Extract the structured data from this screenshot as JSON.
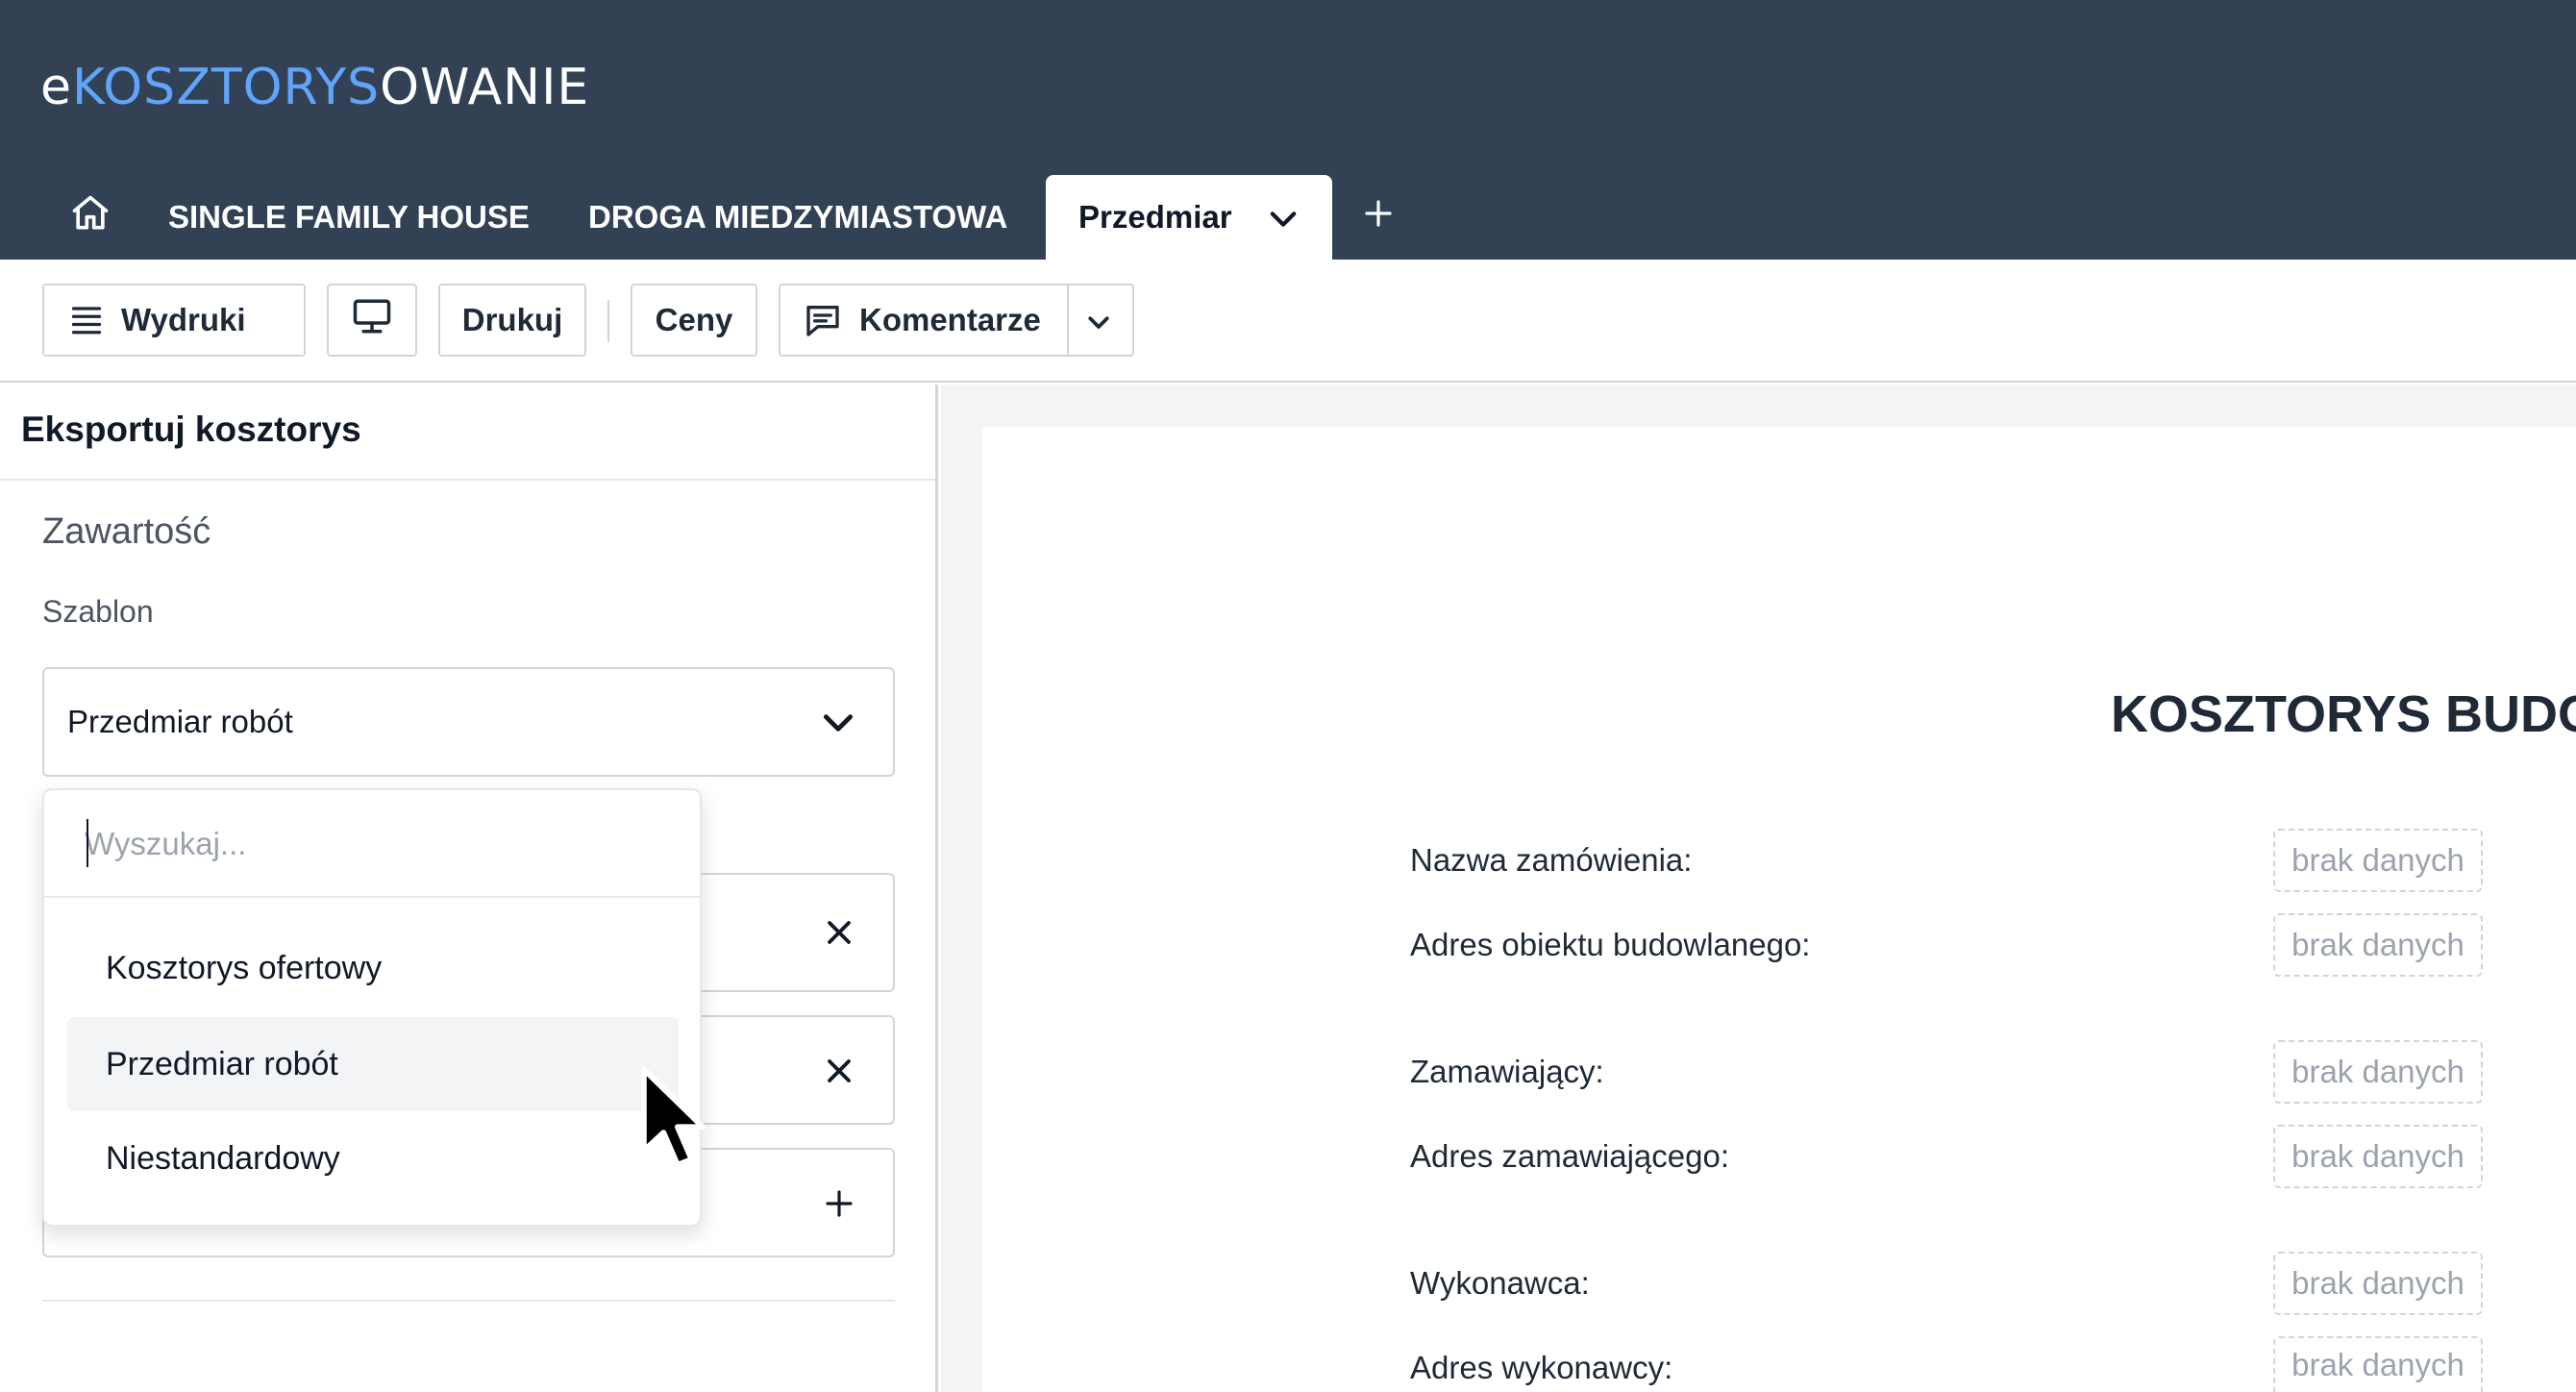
{
  "app": {
    "logo": {
      "prefix": "e",
      "middle": "KOSZTORYS",
      "suffix": "OWANIE"
    },
    "colors": {
      "header_bg": "#334155",
      "logo_accent": "#60a5fa",
      "logo_text": "#ffffff"
    }
  },
  "tabs": {
    "home_icon": "home-icon",
    "items": [
      {
        "label": "SINGLE FAMILY HOUSE"
      },
      {
        "label": "DROGA MIEDZYMIASTOWA"
      },
      {
        "label": "Przedmiar"
      }
    ]
  },
  "toolbar": {
    "wydruki": "Wydruki",
    "drukuj": "Drukuj",
    "ceny": "Ceny",
    "komentarze": "Komentarze"
  },
  "panel": {
    "title": "Eksportuj kosztorys",
    "section": "Zawartość",
    "template_label": "Szablon",
    "template_value": "Przedmiar robót"
  },
  "dropdown": {
    "search_placeholder": "Wyszukaj...",
    "options": [
      "Kosztorys ofertowy",
      "Przedmiar robót",
      "Niestandardowy"
    ],
    "selected": "Przedmiar robót"
  },
  "preview": {
    "title": "KOSZTORYS BUDO",
    "fields": [
      {
        "label": "Nazwa zamówienia:",
        "value": "brak danych"
      },
      {
        "label": "Adres obiektu budowlanego:",
        "value": "brak danych"
      },
      {
        "label": "Zamawiający:",
        "value": "brak danych"
      },
      {
        "label": "Adres zamawiającego:",
        "value": "brak danych"
      },
      {
        "label": "Wykonawca:",
        "value": "brak danych"
      },
      {
        "label": "Adres wykonawcy:",
        "value": "brak danych"
      }
    ]
  }
}
